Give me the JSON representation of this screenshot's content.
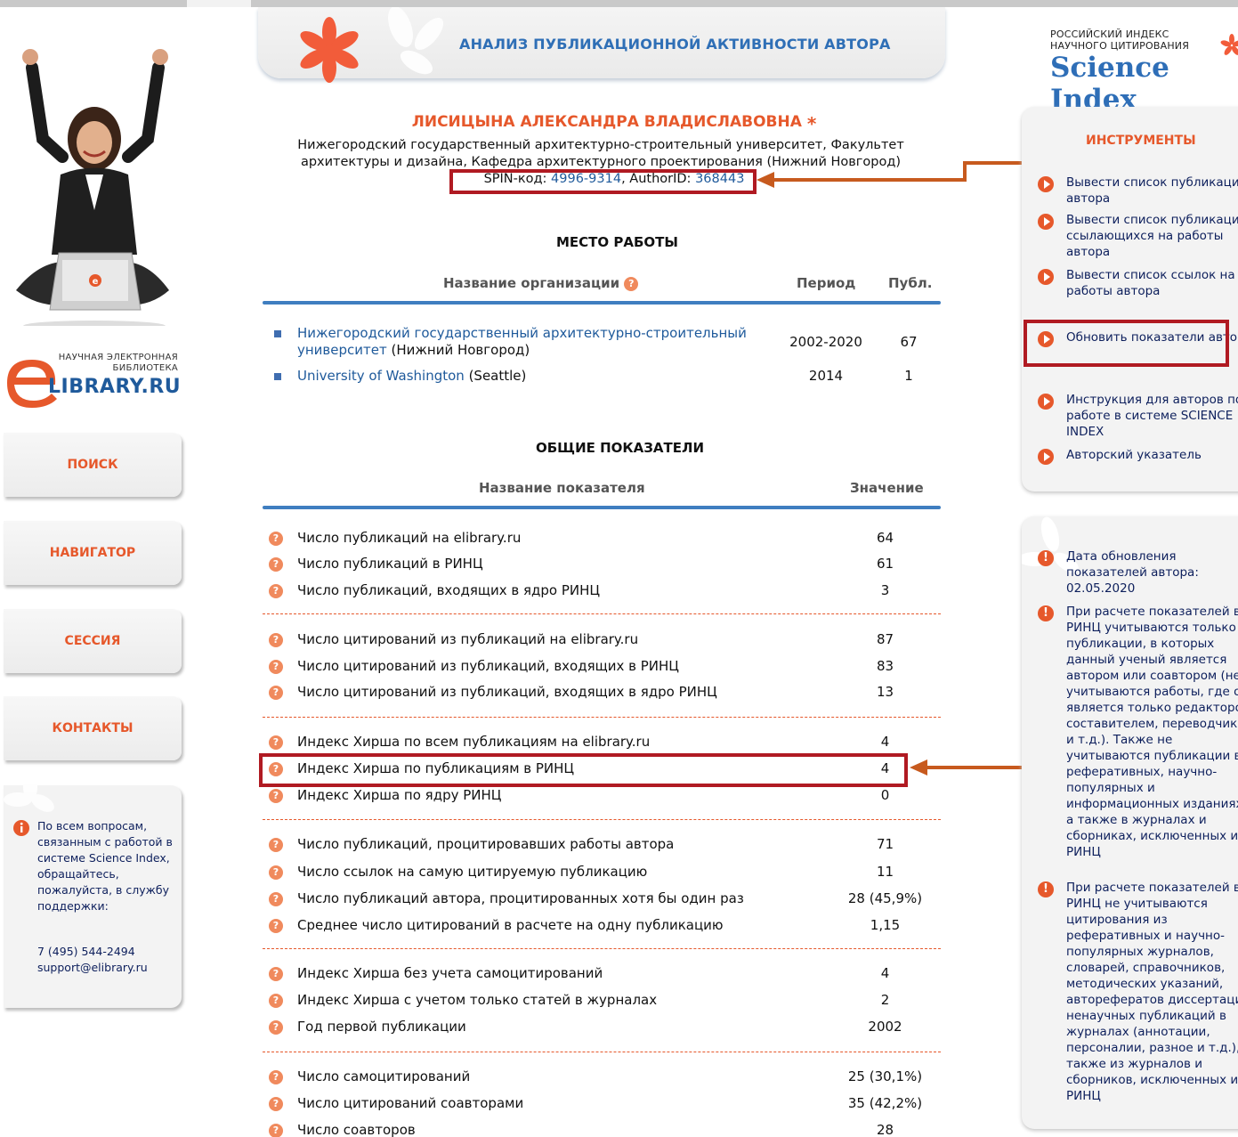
{
  "header": {
    "title": "АНАЛИЗ ПУБЛИКАЦИОННОЙ АКТИВНОСТИ АВТОРА"
  },
  "logo": {
    "small_line1": "НАУЧНАЯ ЭЛЕКТРОННАЯ",
    "small_line2": "БИБЛИОТЕКА",
    "big": "LIBRARY.RU"
  },
  "nav": [
    "ПОИСК",
    "НАВИГАТОР",
    "СЕССИЯ",
    "КОНТАКТЫ"
  ],
  "support": {
    "text": "По всем вопросам, связанным с работой в системе Science Index, обращайтесь, пожалуйста, в службу поддержки:",
    "phone": "7 (495) 544-2494",
    "email": "support@elibrary.ru"
  },
  "author": {
    "name": "ЛИСИЦЫНА АЛЕКСАНДРА ВЛАДИСЛАВОВНА",
    "affil_line1": "Нижегородский государственный архитектурно-строительный университет, Факультет",
    "affil_line2": "архитектуры и дизайна, Кафедра архитектурного проектирования (Нижний Новгород)",
    "spin_label": "SPIN-код: ",
    "spin": "4996-9314",
    "author_id_label": ", AuthorID: ",
    "author_id": "368443"
  },
  "workplace": {
    "title": "МЕСТО РАБОТЫ",
    "col_org": "Название организации",
    "col_period": "Период",
    "col_pubs": "Публ.",
    "rows": [
      {
        "org_line1": "Нижегородский государственный архитектурно-строительный",
        "org_line2": "университет",
        "city": " (Нижний Новгород)",
        "period": "2002-2020",
        "pubs": "67"
      },
      {
        "org_line1": "University of Washington",
        "city": " (Seattle)",
        "period": "2014",
        "pubs": "1"
      }
    ]
  },
  "metrics": {
    "title": "ОБЩИЕ ПОКАЗАТЕЛИ",
    "col_name": "Название показателя",
    "col_value": "Значение",
    "rows": [
      {
        "label": "Число публикаций на elibrary.ru",
        "value": "64"
      },
      {
        "label": "Число публикаций в РИНЦ",
        "value": "61"
      },
      {
        "label": "Число публикаций, входящих в ядро РИНЦ",
        "value": "3"
      },
      {
        "label": "Число цитирований из публикаций на elibrary.ru",
        "value": "87"
      },
      {
        "label": "Число цитирований из публикаций, входящих в РИНЦ",
        "value": "83"
      },
      {
        "label": "Число цитирований из публикаций, входящих в ядро РИНЦ",
        "value": "13"
      },
      {
        "label": "Индекс Хирша по всем публикациям на elibrary.ru",
        "value": "4"
      },
      {
        "label": "Индекс Хирша по публикациям в РИНЦ",
        "value": "4"
      },
      {
        "label": "Индекс Хирша по ядру РИНЦ",
        "value": "0"
      },
      {
        "label": "Число публикаций, процитировавших работы автора",
        "value": "71"
      },
      {
        "label": "Число ссылок на самую цитируемую публикацию",
        "value": "11"
      },
      {
        "label": "Число публикаций автора, процитированных хотя бы один раз",
        "value": "28 (45,9%)"
      },
      {
        "label": "Среднее число цитирований в расчете на одну публикацию",
        "value": "1,15"
      },
      {
        "label": "Индекс Хирша без учета самоцитирований",
        "value": "4"
      },
      {
        "label": "Индекс Хирша с учетом только статей в журналах",
        "value": "2"
      },
      {
        "label": "Год первой публикации",
        "value": "2002"
      },
      {
        "label": "Число самоцитирований",
        "value": "25 (30,1%)"
      },
      {
        "label": "Число цитирований соавторами",
        "value": "35 (42,2%)"
      },
      {
        "label": "Число соавторов",
        "value": "28"
      }
    ]
  },
  "science_index": {
    "small_line1": "РОССИЙСКИЙ ИНДЕКС",
    "small_line2": "НАУЧНОГО ЦИТИРОВАНИЯ",
    "big": "Science Index"
  },
  "tools": {
    "title": "ИНСТРУМЕНТЫ",
    "items": [
      "Вывести список публикаций автора",
      "Вывести список публикаций, ссылающихся на работы автора",
      "Вывести список ссылок на работы автора",
      "Обновить показатели автора",
      "Инструкция для авторов по работе в системе SCIENCE INDEX",
      "Авторский указатель"
    ]
  },
  "info": {
    "items": [
      "Дата обновления показателей автора: 02.05.2020",
      "При расчете показателей в РИНЦ учитываются только публикации, в которых данный ученый является автором или соавтором (не учитываются работы, где он является только редактором, составителем, переводчиком и т.д.). Также не учитываются публикации в реферативных, научно-популярных и информационных изданиях, а также в журналах и сборниках, исключенных из РИНЦ",
      "При расчете показателей в РИНЦ не учитываются цитирования из реферативных и научно-популярных журналов, словарей, справочников, методических указаний, авторефератов диссертаций, ненаучных публикаций в журналах (аннотации, персоналии, разное и т.д.), а также из журналов и сборников, исключенных из РИНЦ"
    ]
  },
  "colors": {
    "accent": "#e6582b",
    "link": "#1f5a9b",
    "highlight_box": "#b01a22",
    "header_rule": "#3f7ec0"
  }
}
